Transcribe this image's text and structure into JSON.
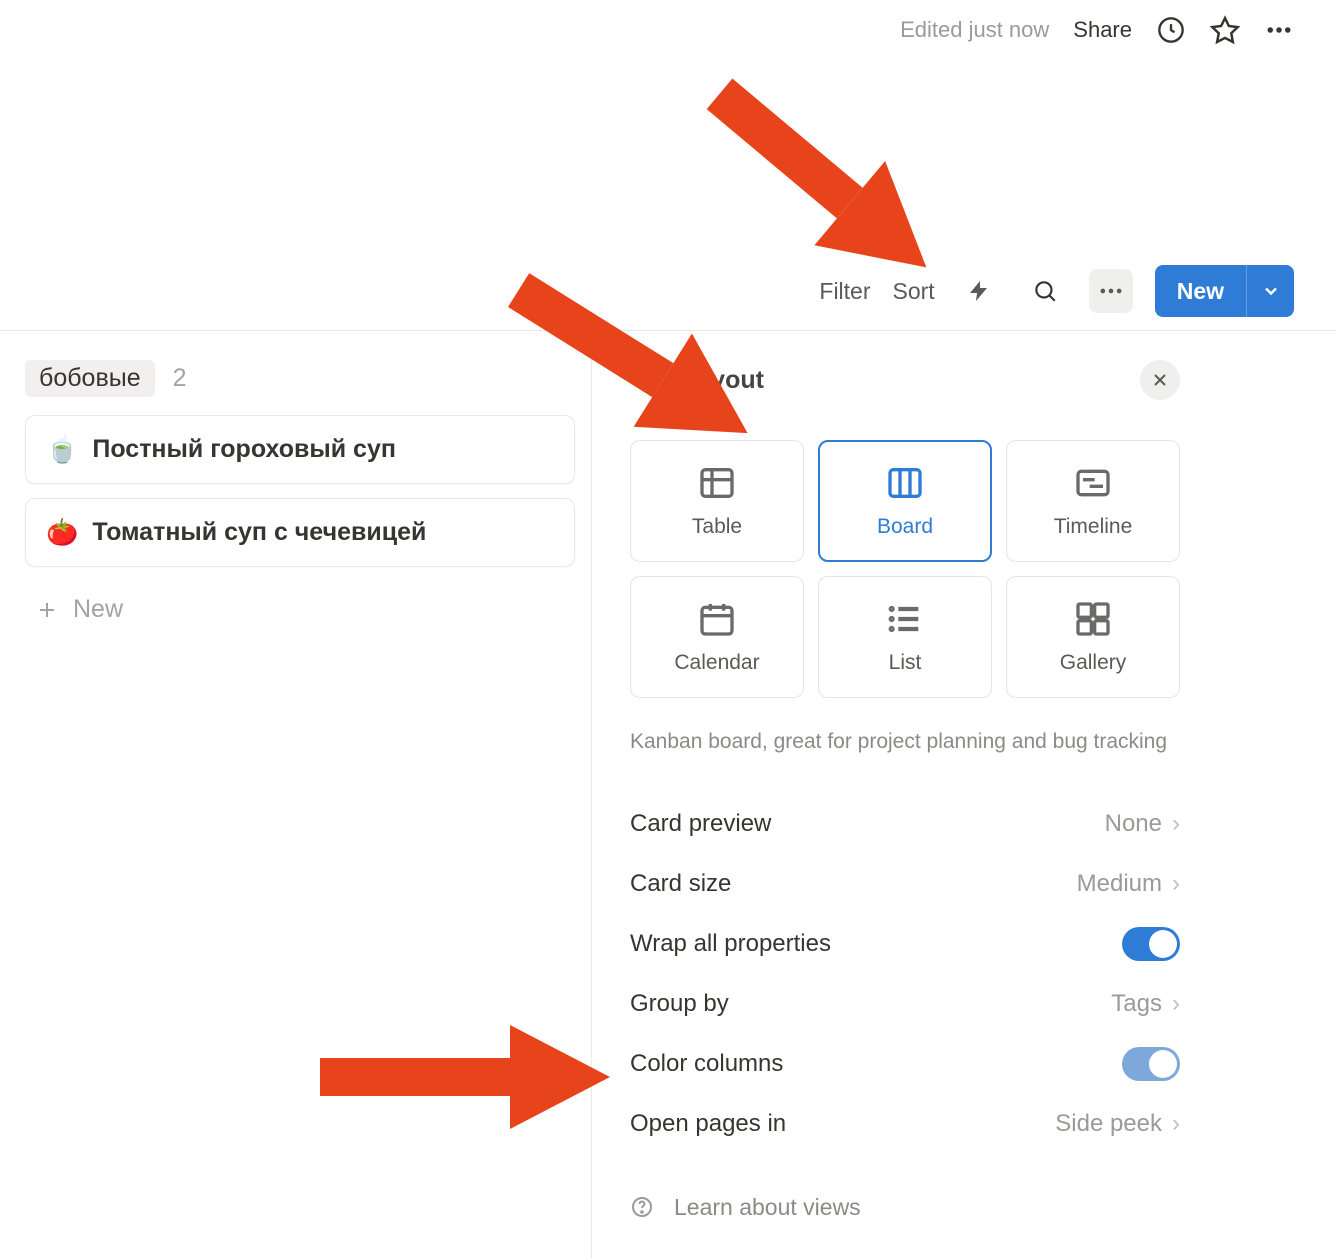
{
  "topbar": {
    "edited": "Edited just now",
    "share": "Share"
  },
  "toolbar": {
    "filter": "Filter",
    "sort": "Sort",
    "new_label": "New"
  },
  "board": {
    "group_tag": "бобовые",
    "group_count": "2",
    "cards": [
      {
        "emoji": "🍵",
        "title": "Постный гороховый суп"
      },
      {
        "emoji": "🍅",
        "title": "Томатный суп с чечевицей"
      }
    ],
    "new_label": "New"
  },
  "panel": {
    "title": "Layout",
    "description": "Kanban board, great for project planning and bug tracking",
    "layouts": {
      "table": "Table",
      "board": "Board",
      "timeline": "Timeline",
      "calendar": "Calendar",
      "list": "List",
      "gallery": "Gallery"
    },
    "settings": {
      "card_preview_label": "Card preview",
      "card_preview_value": "None",
      "card_size_label": "Card size",
      "card_size_value": "Medium",
      "wrap_label": "Wrap all properties",
      "group_by_label": "Group by",
      "group_by_value": "Tags",
      "color_columns_label": "Color columns",
      "open_pages_label": "Open pages in",
      "open_pages_value": "Side peek"
    },
    "learn": "Learn about views"
  }
}
